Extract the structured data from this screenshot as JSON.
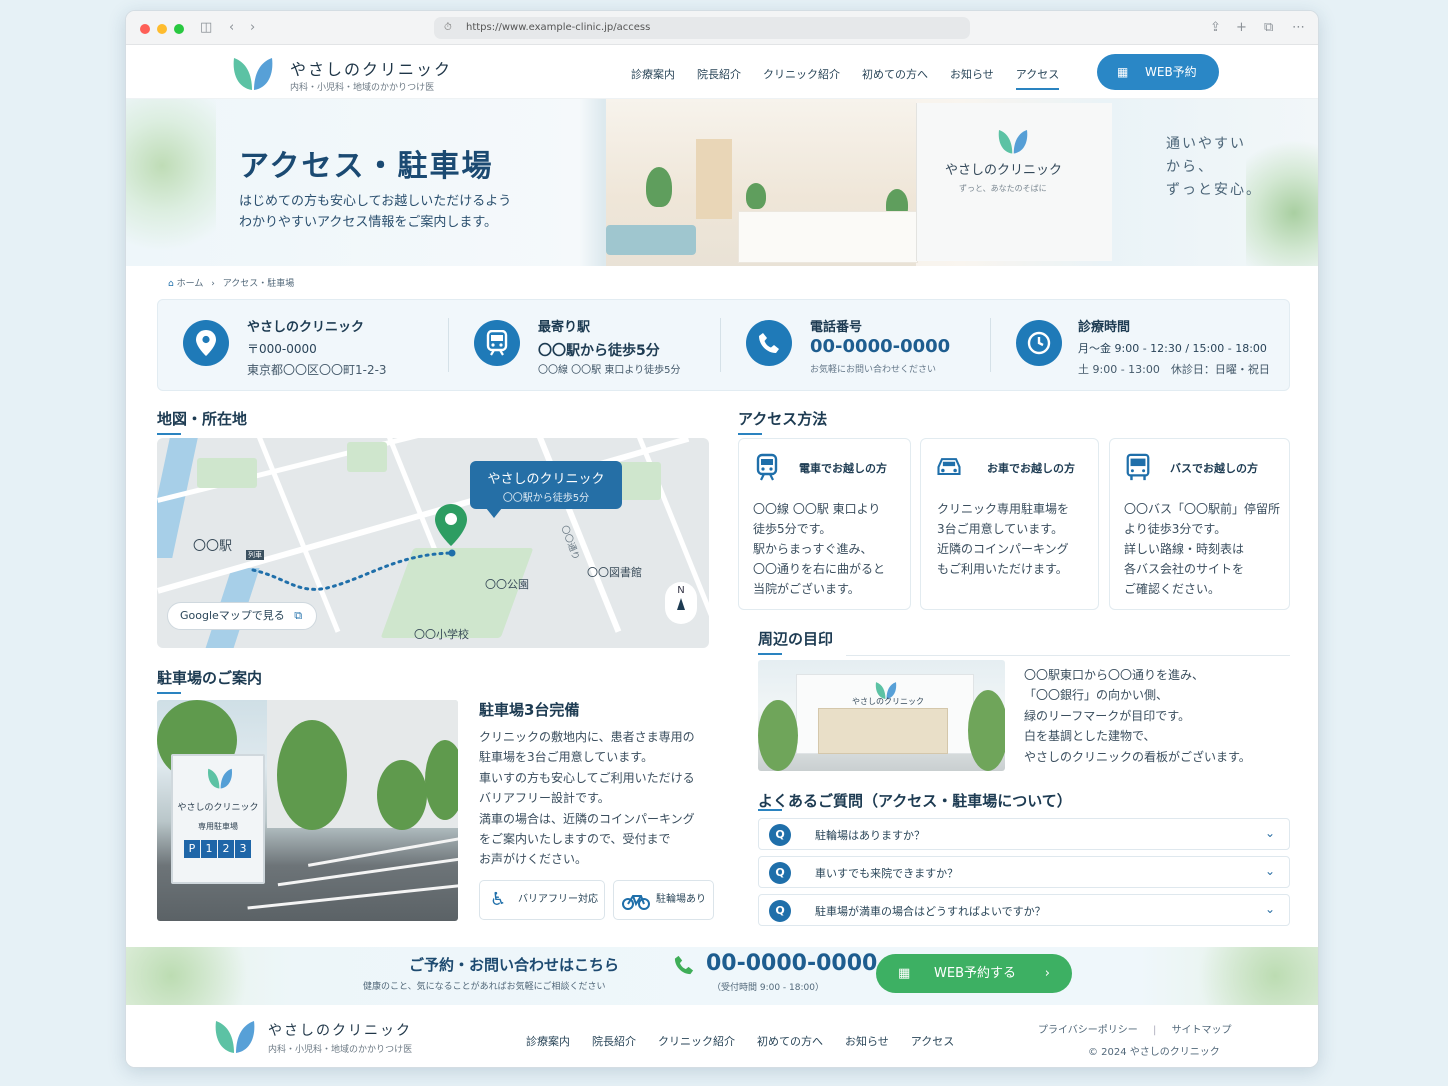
{
  "browser": {
    "url": "https://www.example-clinic.jp/access"
  },
  "header": {
    "brand": "やさしのクリニック",
    "subtitle": "内科・小児科・地域のかかりつけ医",
    "nav": [
      "診療案内",
      "院長紹介",
      "クリニック紹介",
      "初めての方へ",
      "お知らせ",
      "アクセス"
    ],
    "active_nav": "アクセス",
    "web_button": "WEB予約"
  },
  "hero": {
    "title": "アクセス・駐車場",
    "lead_1": "はじめての方も安心してお越しいただけるよう",
    "lead_2": "わかりやすいアクセス情報をご案内します。",
    "tagline_1": "通いやすい",
    "tagline_2": "から、",
    "tagline_3": "ずっと安心。",
    "sign_name": "やさしのクリニック",
    "sign_sub": "ずっと、あなたのそばに"
  },
  "breadcrumb": {
    "home": "ホーム",
    "separator": "›",
    "current": "アクセス・駐車場"
  },
  "info": {
    "clinic": {
      "title": "やさしのクリニック",
      "line1": "〒000-0000",
      "line2": "東京都〇〇区〇〇町1-2-3"
    },
    "station": {
      "title": "最寄り駅",
      "line1": "〇〇駅から徒歩5分",
      "line2": "〇〇線 〇〇駅 東口より徒歩5分"
    },
    "phone": {
      "title": "電話番号",
      "number": "00-0000-0000",
      "note": "お気軽にお問い合わせください"
    },
    "hours": {
      "title": "診療時間",
      "line1": "月〜金 9:00 - 12:30 / 15:00 - 18:00",
      "line2": "土 9:00 - 13:00　休診日：日曜・祝日"
    }
  },
  "map_section": {
    "title": "地図・所在地",
    "bubble_name": "やさしのクリニック",
    "bubble_sub": "〇〇駅から徒歩5分",
    "station_label": "〇〇駅",
    "station_tag": "列車",
    "road_label": "〇〇通り",
    "park_label": "〇〇公園",
    "library_label": "〇〇図書館",
    "school_label": "〇〇小学校",
    "google_button": "Googleマップで見る",
    "compass": "N"
  },
  "parking": {
    "title": "駐車場のご案内",
    "heading": "駐車場3台完備",
    "lines": [
      "クリニックの敷地内に、患者さま専用の",
      "駐車場を3台ご用意しています。",
      "車いすの方も安心してご利用いただける",
      "バリアフリー設計です。",
      "満車の場合は、近隣のコインパーキング",
      "をご案内いたしますので、受付まで",
      "お声がけください。"
    ],
    "sign_name": "やさしのクリニック",
    "sign_sub": "専用駐車場",
    "slots": [
      "P",
      "1",
      "2",
      "3"
    ],
    "chip_barrier": "バリアフリー対応",
    "chip_bike": "駐輪場あり"
  },
  "access": {
    "title": "アクセス方法",
    "cards": [
      {
        "title": "電車でお越しの方",
        "lines": [
          "〇〇線 〇〇駅 東口より",
          "徒歩5分です。",
          "駅からまっすぐ進み、",
          "〇〇通りを右に曲がると",
          "当院がございます。"
        ]
      },
      {
        "title": "お車でお越しの方",
        "lines": [
          "クリニック専用駐車場を",
          "3台ご用意しています。",
          "近隣のコインパーキング",
          "もご利用いただけます。"
        ]
      },
      {
        "title": "バスでお越しの方",
        "lines": [
          "〇〇バス「〇〇駅前」停留所",
          "より徒歩3分です。",
          "詳しい路線・時刻表は",
          "各バス会社のサイトを",
          "ご確認ください。"
        ]
      }
    ]
  },
  "landmark": {
    "title": "周辺の目印",
    "sign": "やさしのクリニック",
    "lines": [
      "〇〇駅東口から〇〇通りを進み、",
      "「〇〇銀行」の向かい側、",
      "緑のリーフマークが目印です。",
      "白を基調とした建物で、",
      "やさしのクリニックの看板がございます。"
    ]
  },
  "faq": {
    "title": "よくあるご質問（アクセス・駐車場について）",
    "q_mark": "Q",
    "items": [
      "駐輪場はありますか？",
      "車いすでも来院できますか？",
      "駐車場が満車の場合はどうすればよいですか？"
    ]
  },
  "cta": {
    "title": "ご予約・お問い合わせはこちら",
    "sub": "健康のこと、気になることがあればお気軽にご相談ください",
    "phone": "00-0000-0000",
    "hours": "（受付時間  9:00 - 18:00）",
    "button": "WEB予約する",
    "arrow": "›"
  },
  "footer": {
    "brand": "やさしのクリニック",
    "subtitle": "内科・小児科・地域のかかりつけ医",
    "nav": [
      "診療案内",
      "院長紹介",
      "クリニック紹介",
      "初めての方へ",
      "お知らせ",
      "アクセス"
    ],
    "privacy": "プライバシーポリシー",
    "divider": "|",
    "sitemap": "サイトマップ",
    "copyright": "© 2024 やさしのクリニック"
  },
  "colors": {
    "primary": "#2a87c6",
    "navy": "#1d3b52",
    "green": "#3db063",
    "leaf_light": "#5cc2a4",
    "leaf_dark": "#3a8fd0"
  },
  "icons": [
    "sidebar-icon",
    "back-icon",
    "forward-icon",
    "lock-icon",
    "share-icon",
    "new-tab-icon",
    "tabs-icon",
    "calendar-icon",
    "home-icon",
    "location-pin-icon",
    "train-icon",
    "phone-icon",
    "clock-icon",
    "car-icon",
    "bus-icon",
    "wheelchair-icon",
    "bicycle-icon",
    "external-link-icon",
    "chevron-down-icon"
  ]
}
